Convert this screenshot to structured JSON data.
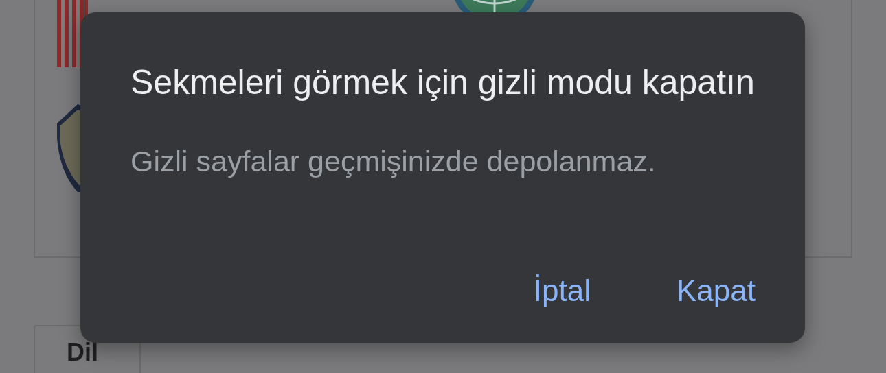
{
  "background_page": {
    "language_button": {
      "label": "Dil"
    }
  },
  "dialog": {
    "title": "Sekmeleri görmek için gizli modu kapatın",
    "message": "Gizli sayfalar geçmişinizde depolanmaz.",
    "buttons": [
      {
        "label": "İptal"
      },
      {
        "label": "Kapat"
      }
    ]
  }
}
